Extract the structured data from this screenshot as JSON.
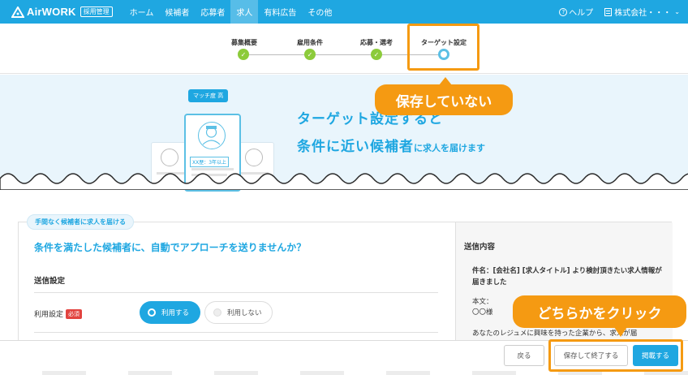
{
  "header": {
    "logo_text": "AirWORK",
    "logo_badge": "採用管理",
    "nav": [
      "ホーム",
      "候補者",
      "応募者",
      "求人",
      "有料広告",
      "その他"
    ],
    "active_nav": "求人",
    "help_icon_glyph": "?",
    "help_label": "ヘルプ",
    "company_label": "株式会社・・・",
    "chevron_glyph": "⌄",
    "brand_color": "#1fa7e1"
  },
  "steps": [
    {
      "label": "募集概要",
      "status": "done"
    },
    {
      "label": "雇用条件",
      "status": "done"
    },
    {
      "label": "応募・選考",
      "status": "done"
    },
    {
      "label": "ターゲット設定",
      "status": "current"
    }
  ],
  "hero": {
    "title": "ターゲット設定すると",
    "subtitle_big": "条件に近い候補者",
    "subtitle_small": "に求人を届けます",
    "match_badge": "マッチ度 高",
    "card_tag": "XX歴：3年以上"
  },
  "form": {
    "pill_label": "手間なく候補者に求人を届ける",
    "question": "条件を満たした候補者に、自動でアプローチを送りませんか？",
    "section_title": "送信設定",
    "usage_label": "利用設定",
    "required_badge": "必須",
    "option_use": "利用する",
    "option_nouse": "利用しない"
  },
  "preview": {
    "title": "送信内容",
    "subject": "件名：[会社名] [求人タイトル] より検討頂きたい求人情報が届きました",
    "body_label": "本文：",
    "body_name": "〇〇様",
    "body_text": "あなたのレジュメに興味を持った企業から、求人が届"
  },
  "footer": {
    "back": "戻る",
    "save_exit": "保存して終了する",
    "publish": "掲載する"
  },
  "annotations": {
    "not_saved": "保存していない",
    "click_either": "どちらかをクリック",
    "color": "#f59a12"
  }
}
